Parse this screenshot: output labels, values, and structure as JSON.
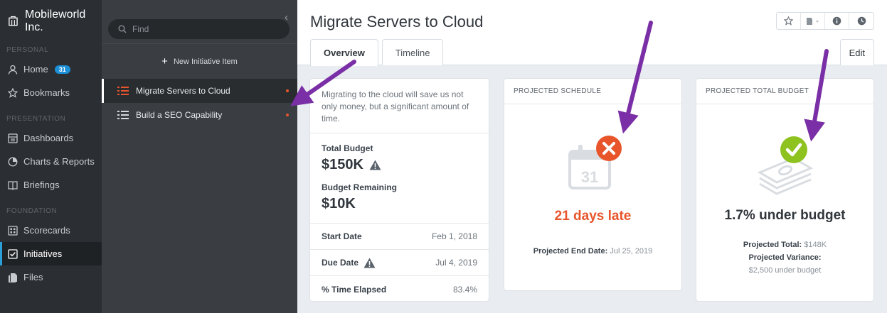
{
  "nav": {
    "brand": "Mobileworld Inc.",
    "sections": {
      "personal": "PERSONAL",
      "presentation": "PRESENTATION",
      "foundation": "FOUNDATION"
    },
    "items": {
      "home": "Home",
      "home_badge": "31",
      "bookmarks": "Bookmarks",
      "dashboards": "Dashboards",
      "charts": "Charts & Reports",
      "briefings": "Briefings",
      "scorecards": "Scorecards",
      "initiatives": "Initiatives",
      "files": "Files"
    }
  },
  "list": {
    "collapse": "‹",
    "search_placeholder": "Find",
    "new_item": "New Initiative Item",
    "initiatives": [
      {
        "name": "Migrate Servers to Cloud"
      },
      {
        "name": "Build a SEO Capability"
      }
    ]
  },
  "main": {
    "title": "Migrate Servers to Cloud",
    "tabs": {
      "overview": "Overview",
      "timeline": "Timeline"
    },
    "edit": "Edit",
    "description": "Migrating to the cloud will save us not only money, but a significant amount of time.",
    "total_budget_label": "Total Budget",
    "total_budget": "$150K",
    "remaining_label": "Budget Remaining",
    "remaining": "$10K",
    "start_label": "Start Date",
    "start_value": "Feb 1, 2018",
    "due_label": "Due Date",
    "due_value": "Jul 4, 2019",
    "elapsed_label": "% Time Elapsed",
    "elapsed_value": "83.4%",
    "schedule": {
      "header": "PROJECTED SCHEDULE",
      "calendar_day": "31",
      "status": "21 days late",
      "end_label": "Projected End Date:",
      "end_value": "Jul 25, 2019"
    },
    "budget": {
      "header": "PROJECTED TOTAL BUDGET",
      "status": "1.7% under budget",
      "total_label": "Projected Total:",
      "total_value": "$148K",
      "variance_label": "Projected Variance:",
      "variance_value": "$2,500 under budget"
    }
  },
  "colors": {
    "late": "#e8552b",
    "ok": "#8dc21f",
    "badge": "#1c8fd6",
    "annotation_arrow": "#7a2fa6"
  }
}
